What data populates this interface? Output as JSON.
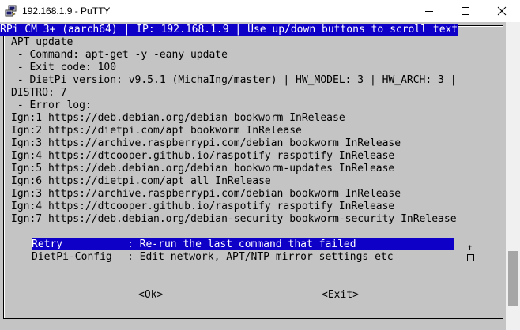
{
  "window": {
    "title": "192.168.1.9 - PuTTY",
    "icons": [
      "putty-icon",
      "minimize-icon",
      "maximize-icon",
      "close-icon"
    ]
  },
  "terminal": {
    "header": "RPi CM 3+ (aarch64) | IP: 192.168.1.9 | Use up/down buttons to scroll text",
    "lines": [
      "APT update",
      " - Command: apt-get -y -eany update",
      " - Exit code: 100",
      " - DietPi version: v9.5.1 (MichaIng/master) | HW_MODEL: 3 | HW_ARCH: 3 |",
      "DISTRO: 7",
      " - Error log:",
      "Ign:1 https://deb.debian.org/debian bookworm InRelease",
      "Ign:2 https://dietpi.com/apt bookworm InRelease",
      "Ign:3 https://archive.raspberrypi.com/debian bookworm InRelease",
      "Ign:4 https://dtcooper.github.io/raspotify raspotify InRelease",
      "Ign:5 https://deb.debian.org/debian bookworm-updates InRelease",
      "Ign:6 https://dietpi.com/apt all InRelease",
      "Ign:3 https://archive.raspberrypi.com/debian bookworm InRelease",
      "Ign:4 https://dtcooper.github.io/raspotify raspotify InRelease",
      "Ign:7 https://deb.debian.org/debian-security bookworm-security InRelease"
    ],
    "menu": [
      {
        "key": "Retry",
        "desc": ": Re-run the last command that failed"
      },
      {
        "key": "DietPi-Config",
        "desc": ": Edit network, APT/NTP mirror settings etc"
      }
    ],
    "scroll_arrow": "↑",
    "ok_button": "<Ok>",
    "exit_button": "<Exit>"
  }
}
